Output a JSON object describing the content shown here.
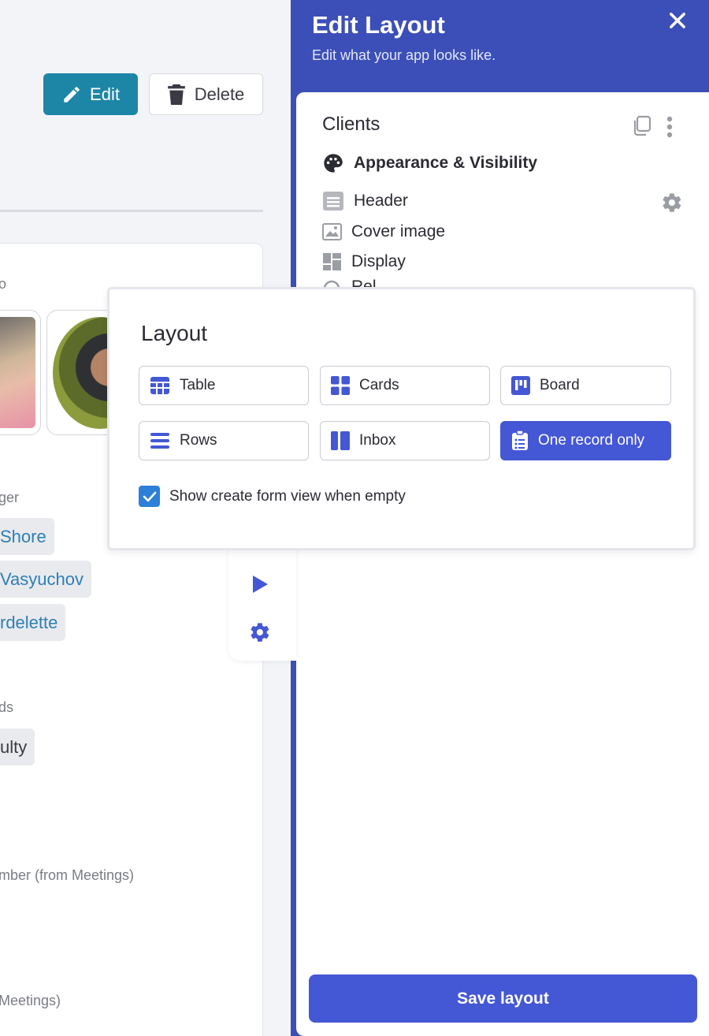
{
  "page": {
    "edit_label": "Edit",
    "delete_label": "Delete"
  },
  "record": {
    "labels": [
      "o",
      "ger",
      "ds",
      "mber (from Meetings)",
      " Meetings)"
    ],
    "managers": [
      "Shore",
      "Vasyuchov",
      "rdelette"
    ],
    "category_tag": "ulty"
  },
  "panel": {
    "title": "Edit Layout",
    "subtitle": "Edit what your app looks like.",
    "table_name": "Clients",
    "section_title": "Appearance & Visibility",
    "options": [
      "Header",
      "Cover image",
      "Display"
    ],
    "hidden_option": "Rel",
    "save_label": "Save layout"
  },
  "layout_popover": {
    "title": "Layout",
    "options": [
      "Table",
      "Cards",
      "Board",
      "Rows",
      "Inbox",
      "One record only"
    ],
    "selected": "One record only",
    "checkbox_label": "Show create form view when empty",
    "checkbox_checked": true
  },
  "colors": {
    "accent": "#4457d4",
    "panel_header": "#3c4fb8",
    "edit_button": "#1d86a7",
    "link": "#2d7fb5"
  }
}
